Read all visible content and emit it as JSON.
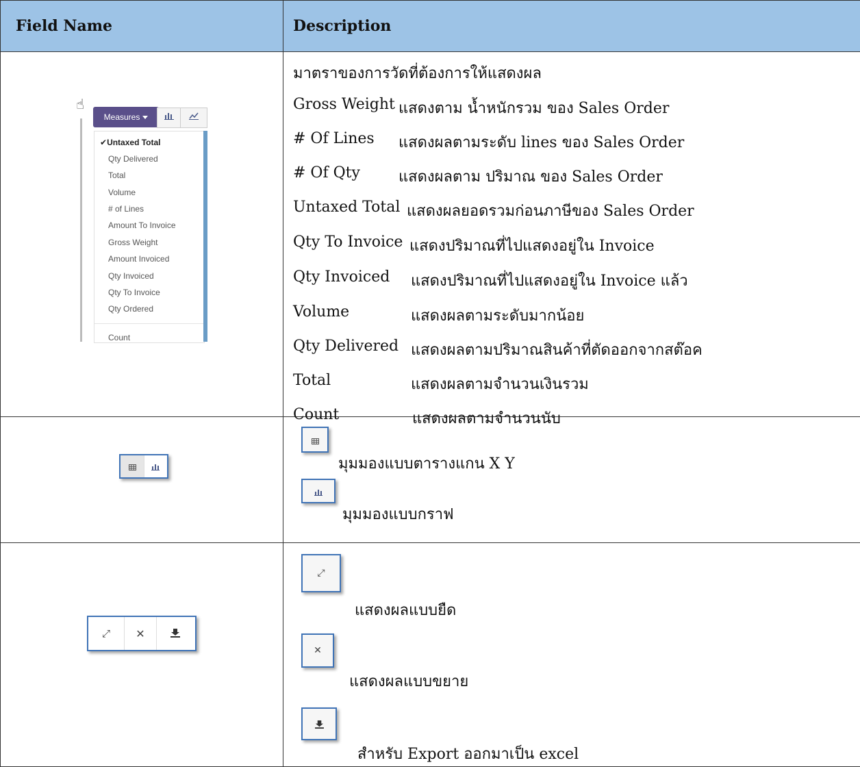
{
  "table": {
    "header_field": "Field Name",
    "header_desc": "Description"
  },
  "measures_menu": {
    "button_label": "Measures",
    "items": [
      "Untaxed Total",
      "Qty Delivered",
      "Total",
      "Volume",
      "# of Lines",
      "Amount To Invoice",
      "Gross Weight",
      "Amount Invoiced",
      "Qty Invoiced",
      "Qty To Invoice",
      "Qty Ordered"
    ],
    "count_label": "Count",
    "checked_item_index": 0,
    "icons": [
      "bar-chart-icon",
      "line-chart-icon",
      "hand-cursor-icon"
    ]
  },
  "measures_desc": {
    "intro": "มาตราของการวัดที่ต้องการให้แสดงผล",
    "rows": [
      {
        "term": "Gross Weight",
        "text": "แสดงตาม น้ำหนักรวม ของ Sales Order"
      },
      {
        "term": "# Of Lines",
        "text": "แสดงผลตามระดับ lines ของ Sales Order"
      },
      {
        "term": "# Of Qty",
        "text": "แสดงผลตาม ปริมาณ ของ Sales Order"
      },
      {
        "term": "Untaxed Total",
        "text": "แสดงผลยอดรวมก่อนภาษีของ Sales Order"
      },
      {
        "term": "Qty To Invoice",
        "text": "แสดงปริมาณที่ไปแสดงอยู่ใน Invoice"
      },
      {
        "term": "Qty Invoiced",
        "text": "แสดงปริมาณที่ไปแสดงอยู่ใน Invoice แล้ว"
      },
      {
        "term": "Volume",
        "text": "แสดงผลตามระดับมากน้อย"
      },
      {
        "term": "Qty Delivered",
        "text": "แสดงผลตามปริมาณสินค้าที่ตัดออกจากสต๊อค"
      },
      {
        "term": "Total",
        "text": "แสดงผลตามจำนวนเงินรวม"
      },
      {
        "term": "Count",
        "text": "แสดงผลตามจำนวนนับ"
      }
    ]
  },
  "view_desc": {
    "pivot": "มุมมองแบบตารางแกน X Y",
    "graph": "มุมมองแบบกราฟ",
    "icons": [
      "table-grid-icon",
      "bar-chart-icon"
    ]
  },
  "action_desc": {
    "expand": "แสดงผลแบบยืด",
    "fullscreen": "แสดงผลแบบขยาย",
    "export": "สำหรับ Export ออกมาเป็น excel",
    "icons": [
      "expand-arrows-icon",
      "fullscreen-icon",
      "download-icon"
    ]
  }
}
